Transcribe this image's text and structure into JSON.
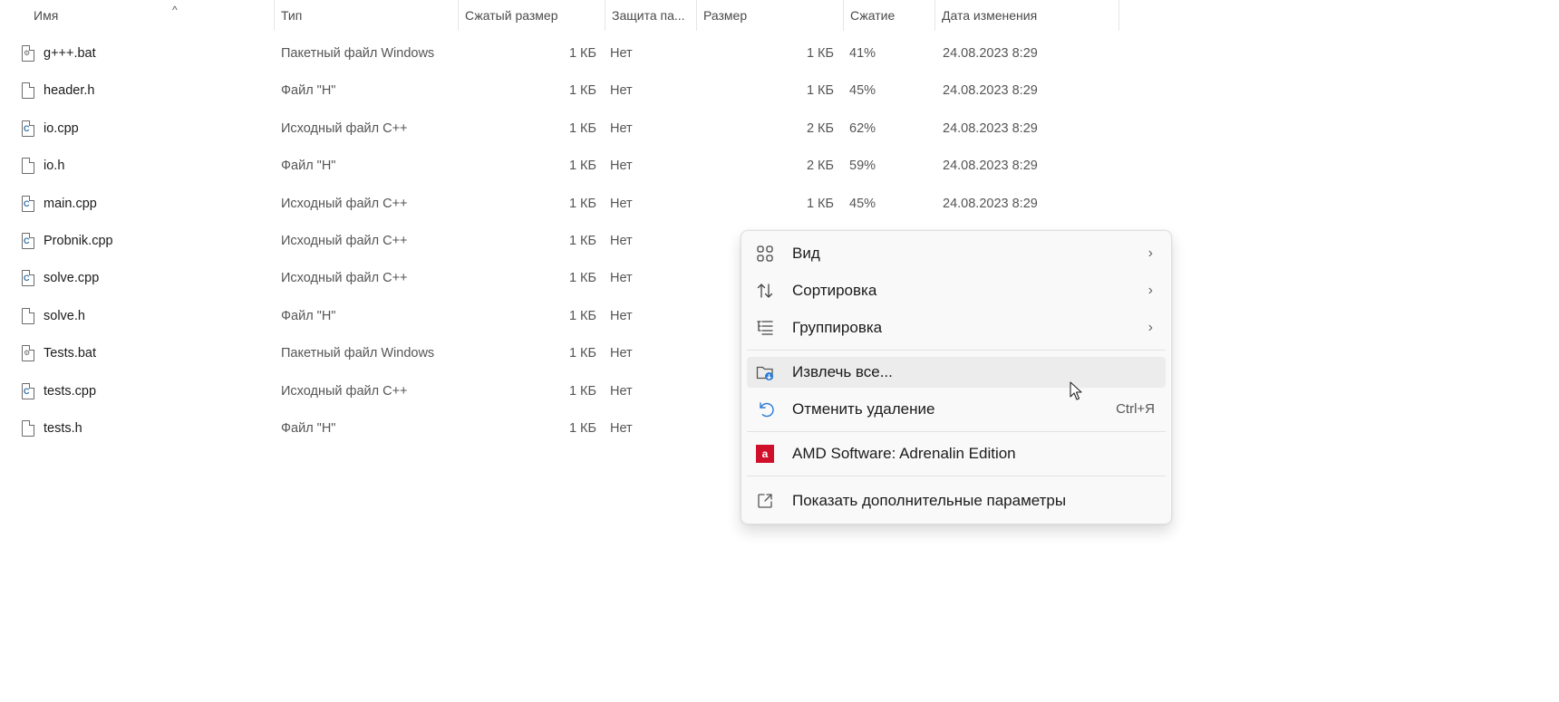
{
  "columns": {
    "name": "Имя",
    "type": "Тип",
    "packed": "Сжатый размер",
    "protection": "Защита па...",
    "size": "Размер",
    "ratio": "Сжатие",
    "date": "Дата изменения"
  },
  "files": [
    {
      "icon": "batch-file-icon",
      "name": "g+++.bat",
      "type": "Пакетный файл Windows",
      "packed": "1 КБ",
      "protection": "Нет",
      "size": "1 КБ",
      "ratio": "41%",
      "date": "24.08.2023 8:29"
    },
    {
      "icon": "generic-file-icon",
      "name": "header.h",
      "type": "Файл \"H\"",
      "packed": "1 КБ",
      "protection": "Нет",
      "size": "1 КБ",
      "ratio": "45%",
      "date": "24.08.2023 8:29"
    },
    {
      "icon": "cpp-file-icon",
      "name": "io.cpp",
      "type": "Исходный файл C++",
      "packed": "1 КБ",
      "protection": "Нет",
      "size": "2 КБ",
      "ratio": "62%",
      "date": "24.08.2023 8:29"
    },
    {
      "icon": "generic-file-icon",
      "name": "io.h",
      "type": "Файл \"H\"",
      "packed": "1 КБ",
      "protection": "Нет",
      "size": "2 КБ",
      "ratio": "59%",
      "date": "24.08.2023 8:29"
    },
    {
      "icon": "cpp-file-icon",
      "name": "main.cpp",
      "type": "Исходный файл C++",
      "packed": "1 КБ",
      "protection": "Нет",
      "size": "1 КБ",
      "ratio": "45%",
      "date": "24.08.2023 8:29"
    },
    {
      "icon": "cpp-file-icon",
      "name": "Probnik.cpp",
      "type": "Исходный файл C++",
      "packed": "1 КБ",
      "protection": "Нет",
      "size": "",
      "ratio": "",
      "date": ""
    },
    {
      "icon": "cpp-file-icon",
      "name": "solve.cpp",
      "type": "Исходный файл C++",
      "packed": "1 КБ",
      "protection": "Нет",
      "size": "",
      "ratio": "",
      "date": ""
    },
    {
      "icon": "generic-file-icon",
      "name": "solve.h",
      "type": "Файл \"H\"",
      "packed": "1 КБ",
      "protection": "Нет",
      "size": "",
      "ratio": "",
      "date": ""
    },
    {
      "icon": "batch-file-icon",
      "name": "Tests.bat",
      "type": "Пакетный файл Windows",
      "packed": "1 КБ",
      "protection": "Нет",
      "size": "",
      "ratio": "",
      "date": ""
    },
    {
      "icon": "cpp-file-icon",
      "name": "tests.cpp",
      "type": "Исходный файл C++",
      "packed": "1 КБ",
      "protection": "Нет",
      "size": "",
      "ratio": "",
      "date": ""
    },
    {
      "icon": "generic-file-icon",
      "name": "tests.h",
      "type": "Файл \"H\"",
      "packed": "1 КБ",
      "protection": "Нет",
      "size": "",
      "ratio": "",
      "date": ""
    }
  ],
  "context_menu": {
    "view": {
      "label": "Вид",
      "icon": "grid-icon"
    },
    "sort": {
      "label": "Сортировка",
      "icon": "sort-icon"
    },
    "group": {
      "label": "Группировка",
      "icon": "group-list-icon"
    },
    "extract": {
      "label": "Извлечь все...",
      "icon": "extract-folder-icon"
    },
    "undo": {
      "label": "Отменить удаление",
      "shortcut": "Ctrl+Я",
      "icon": "undo-icon"
    },
    "amd": {
      "label": "AMD Software: Adrenalin Edition",
      "icon": "amd-logo-icon",
      "logo_text": "a",
      "brand_color": "#d0102b"
    },
    "more": {
      "label": "Показать дополнительные параметры",
      "icon": "share-open-icon"
    }
  },
  "colors": {
    "menu_background": "#f9f9f9",
    "hover_background": "#ececec"
  }
}
